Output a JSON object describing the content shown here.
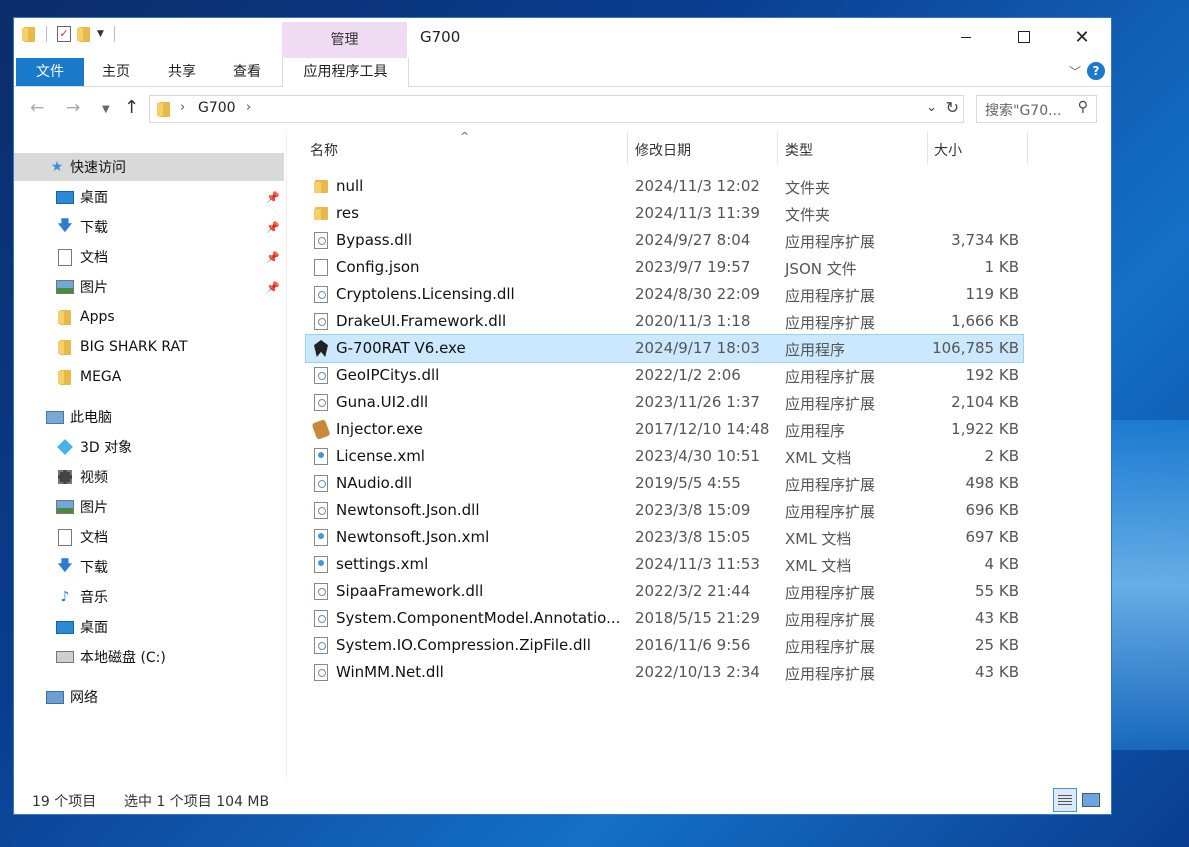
{
  "window": {
    "title": "G700",
    "manage_tab": "管理"
  },
  "ribbon": {
    "tabs": [
      {
        "label": "文件"
      },
      {
        "label": "主页"
      },
      {
        "label": "共享"
      },
      {
        "label": "查看"
      },
      {
        "label": "应用程序工具"
      }
    ]
  },
  "address": {
    "crumb": "G700",
    "search_placeholder": "搜索\"G70...",
    "icons": [
      "back-arrow-icon",
      "forward-arrow-icon",
      "recent-dropdown-icon",
      "up-arrow-icon",
      "dropdown-chevron-icon",
      "refresh-icon",
      "search-icon"
    ]
  },
  "sidebar": {
    "items": [
      {
        "label": "快速访问",
        "icon": "star-icon"
      },
      {
        "label": "桌面",
        "icon": "desktop-icon",
        "pinned": true
      },
      {
        "label": "下载",
        "icon": "download-icon",
        "pinned": true
      },
      {
        "label": "文档",
        "icon": "document-icon",
        "pinned": true
      },
      {
        "label": "图片",
        "icon": "picture-icon",
        "pinned": true
      },
      {
        "label": "Apps",
        "icon": "folder-icon"
      },
      {
        "label": "BIG SHARK RAT",
        "icon": "folder-icon"
      },
      {
        "label": "MEGA",
        "icon": "folder-icon"
      },
      {
        "label": "此电脑",
        "icon": "computer-icon"
      },
      {
        "label": "3D 对象",
        "icon": "3d-objects-icon"
      },
      {
        "label": "视频",
        "icon": "video-icon"
      },
      {
        "label": "图片",
        "icon": "picture-icon"
      },
      {
        "label": "文档",
        "icon": "document-icon"
      },
      {
        "label": "下载",
        "icon": "download-icon"
      },
      {
        "label": "音乐",
        "icon": "music-icon"
      },
      {
        "label": "桌面",
        "icon": "desktop-icon"
      },
      {
        "label": "本地磁盘 (C:)",
        "icon": "drive-icon"
      },
      {
        "label": "网络",
        "icon": "network-icon"
      }
    ]
  },
  "columns": {
    "name": "名称",
    "date": "修改日期",
    "type": "类型",
    "size": "大小"
  },
  "files": [
    {
      "name": "null",
      "date": "2024/11/3 12:02",
      "type": "文件夹",
      "size": "",
      "icon": "folder"
    },
    {
      "name": "res",
      "date": "2024/11/3 11:39",
      "type": "文件夹",
      "size": "",
      "icon": "folder"
    },
    {
      "name": "Bypass.dll",
      "date": "2024/9/27 8:04",
      "type": "应用程序扩展",
      "size": "3,734 KB",
      "icon": "dll"
    },
    {
      "name": "Config.json",
      "date": "2023/9/7 19:57",
      "type": "JSON 文件",
      "size": "1 KB",
      "icon": "json"
    },
    {
      "name": "Cryptolens.Licensing.dll",
      "date": "2024/8/30 22:09",
      "type": "应用程序扩展",
      "size": "119 KB",
      "icon": "dll"
    },
    {
      "name": "DrakeUI.Framework.dll",
      "date": "2020/11/3 1:18",
      "type": "应用程序扩展",
      "size": "1,666 KB",
      "icon": "dll"
    },
    {
      "name": "G-700RAT V6.exe",
      "date": "2024/9/17 18:03",
      "type": "应用程序",
      "size": "106,785 KB",
      "icon": "exe-rat",
      "selected": true
    },
    {
      "name": "GeoIPCitys.dll",
      "date": "2022/1/2 2:06",
      "type": "应用程序扩展",
      "size": "192 KB",
      "icon": "dll"
    },
    {
      "name": "Guna.UI2.dll",
      "date": "2023/11/26 1:37",
      "type": "应用程序扩展",
      "size": "2,104 KB",
      "icon": "dll"
    },
    {
      "name": "Injector.exe",
      "date": "2017/12/10 14:48",
      "type": "应用程序",
      "size": "1,922 KB",
      "icon": "exe-inj"
    },
    {
      "name": "License.xml",
      "date": "2023/4/30 10:51",
      "type": "XML 文档",
      "size": "2 KB",
      "icon": "xml"
    },
    {
      "name": "NAudio.dll",
      "date": "2019/5/5 4:55",
      "type": "应用程序扩展",
      "size": "498 KB",
      "icon": "dll"
    },
    {
      "name": "Newtonsoft.Json.dll",
      "date": "2023/3/8 15:09",
      "type": "应用程序扩展",
      "size": "696 KB",
      "icon": "dll"
    },
    {
      "name": "Newtonsoft.Json.xml",
      "date": "2023/3/8 15:05",
      "type": "XML 文档",
      "size": "697 KB",
      "icon": "xml"
    },
    {
      "name": "settings.xml",
      "date": "2024/11/3 11:53",
      "type": "XML 文档",
      "size": "4 KB",
      "icon": "xml"
    },
    {
      "name": "SipaaFramework.dll",
      "date": "2022/3/2 21:44",
      "type": "应用程序扩展",
      "size": "55 KB",
      "icon": "dll"
    },
    {
      "name": "System.ComponentModel.Annotatio...",
      "date": "2018/5/15 21:29",
      "type": "应用程序扩展",
      "size": "43 KB",
      "icon": "dll"
    },
    {
      "name": "System.IO.Compression.ZipFile.dll",
      "date": "2016/11/6 9:56",
      "type": "应用程序扩展",
      "size": "25 KB",
      "icon": "dll"
    },
    {
      "name": "WinMM.Net.dll",
      "date": "2022/10/13 2:34",
      "type": "应用程序扩展",
      "size": "43 KB",
      "icon": "dll"
    }
  ],
  "status": {
    "item_count": "19 个项目",
    "selection": "选中 1 个项目  104 MB"
  },
  "colors": {
    "accent": "#1979ca",
    "manage_tab_bg": "#f0dcf2",
    "selection_bg": "#cce8ff",
    "sidebar_selection": "#d9d9d9"
  }
}
